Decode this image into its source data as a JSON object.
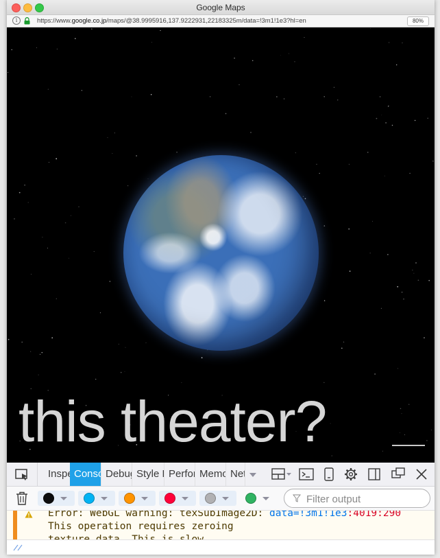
{
  "window": {
    "title": "Google Maps"
  },
  "urlbar": {
    "url_prefix": "https://www.",
    "url_domain": "google.co.jp",
    "url_rest": "/maps/@38.9995916,137.9222931,22183325m/data=!3m1!1e3?hl=en",
    "zoom": "80%"
  },
  "map": {
    "overlay_text": "this theater?"
  },
  "devtools": {
    "tabs": [
      {
        "label": "Inspector"
      },
      {
        "label": "Console"
      },
      {
        "label": "Debugger"
      },
      {
        "label": "Style Editor"
      },
      {
        "label": "Performance"
      },
      {
        "label": "Memory"
      },
      {
        "label": "Network"
      }
    ],
    "filter_colors": [
      "#0c0c0d",
      "#00b3f4",
      "#ff9400",
      "#ff0039",
      "#b1b1b3",
      "#30b362"
    ],
    "filter_placeholder": "Filter output",
    "message": {
      "line1_prefix": "Error: WebGL warning: texSubImage2D: ",
      "line1_link": "data=!3m1!1e3",
      "line1_loc": ":4019:290",
      "line2": "This operation requires zeroing",
      "line3": "texture data. This is slow."
    }
  }
}
